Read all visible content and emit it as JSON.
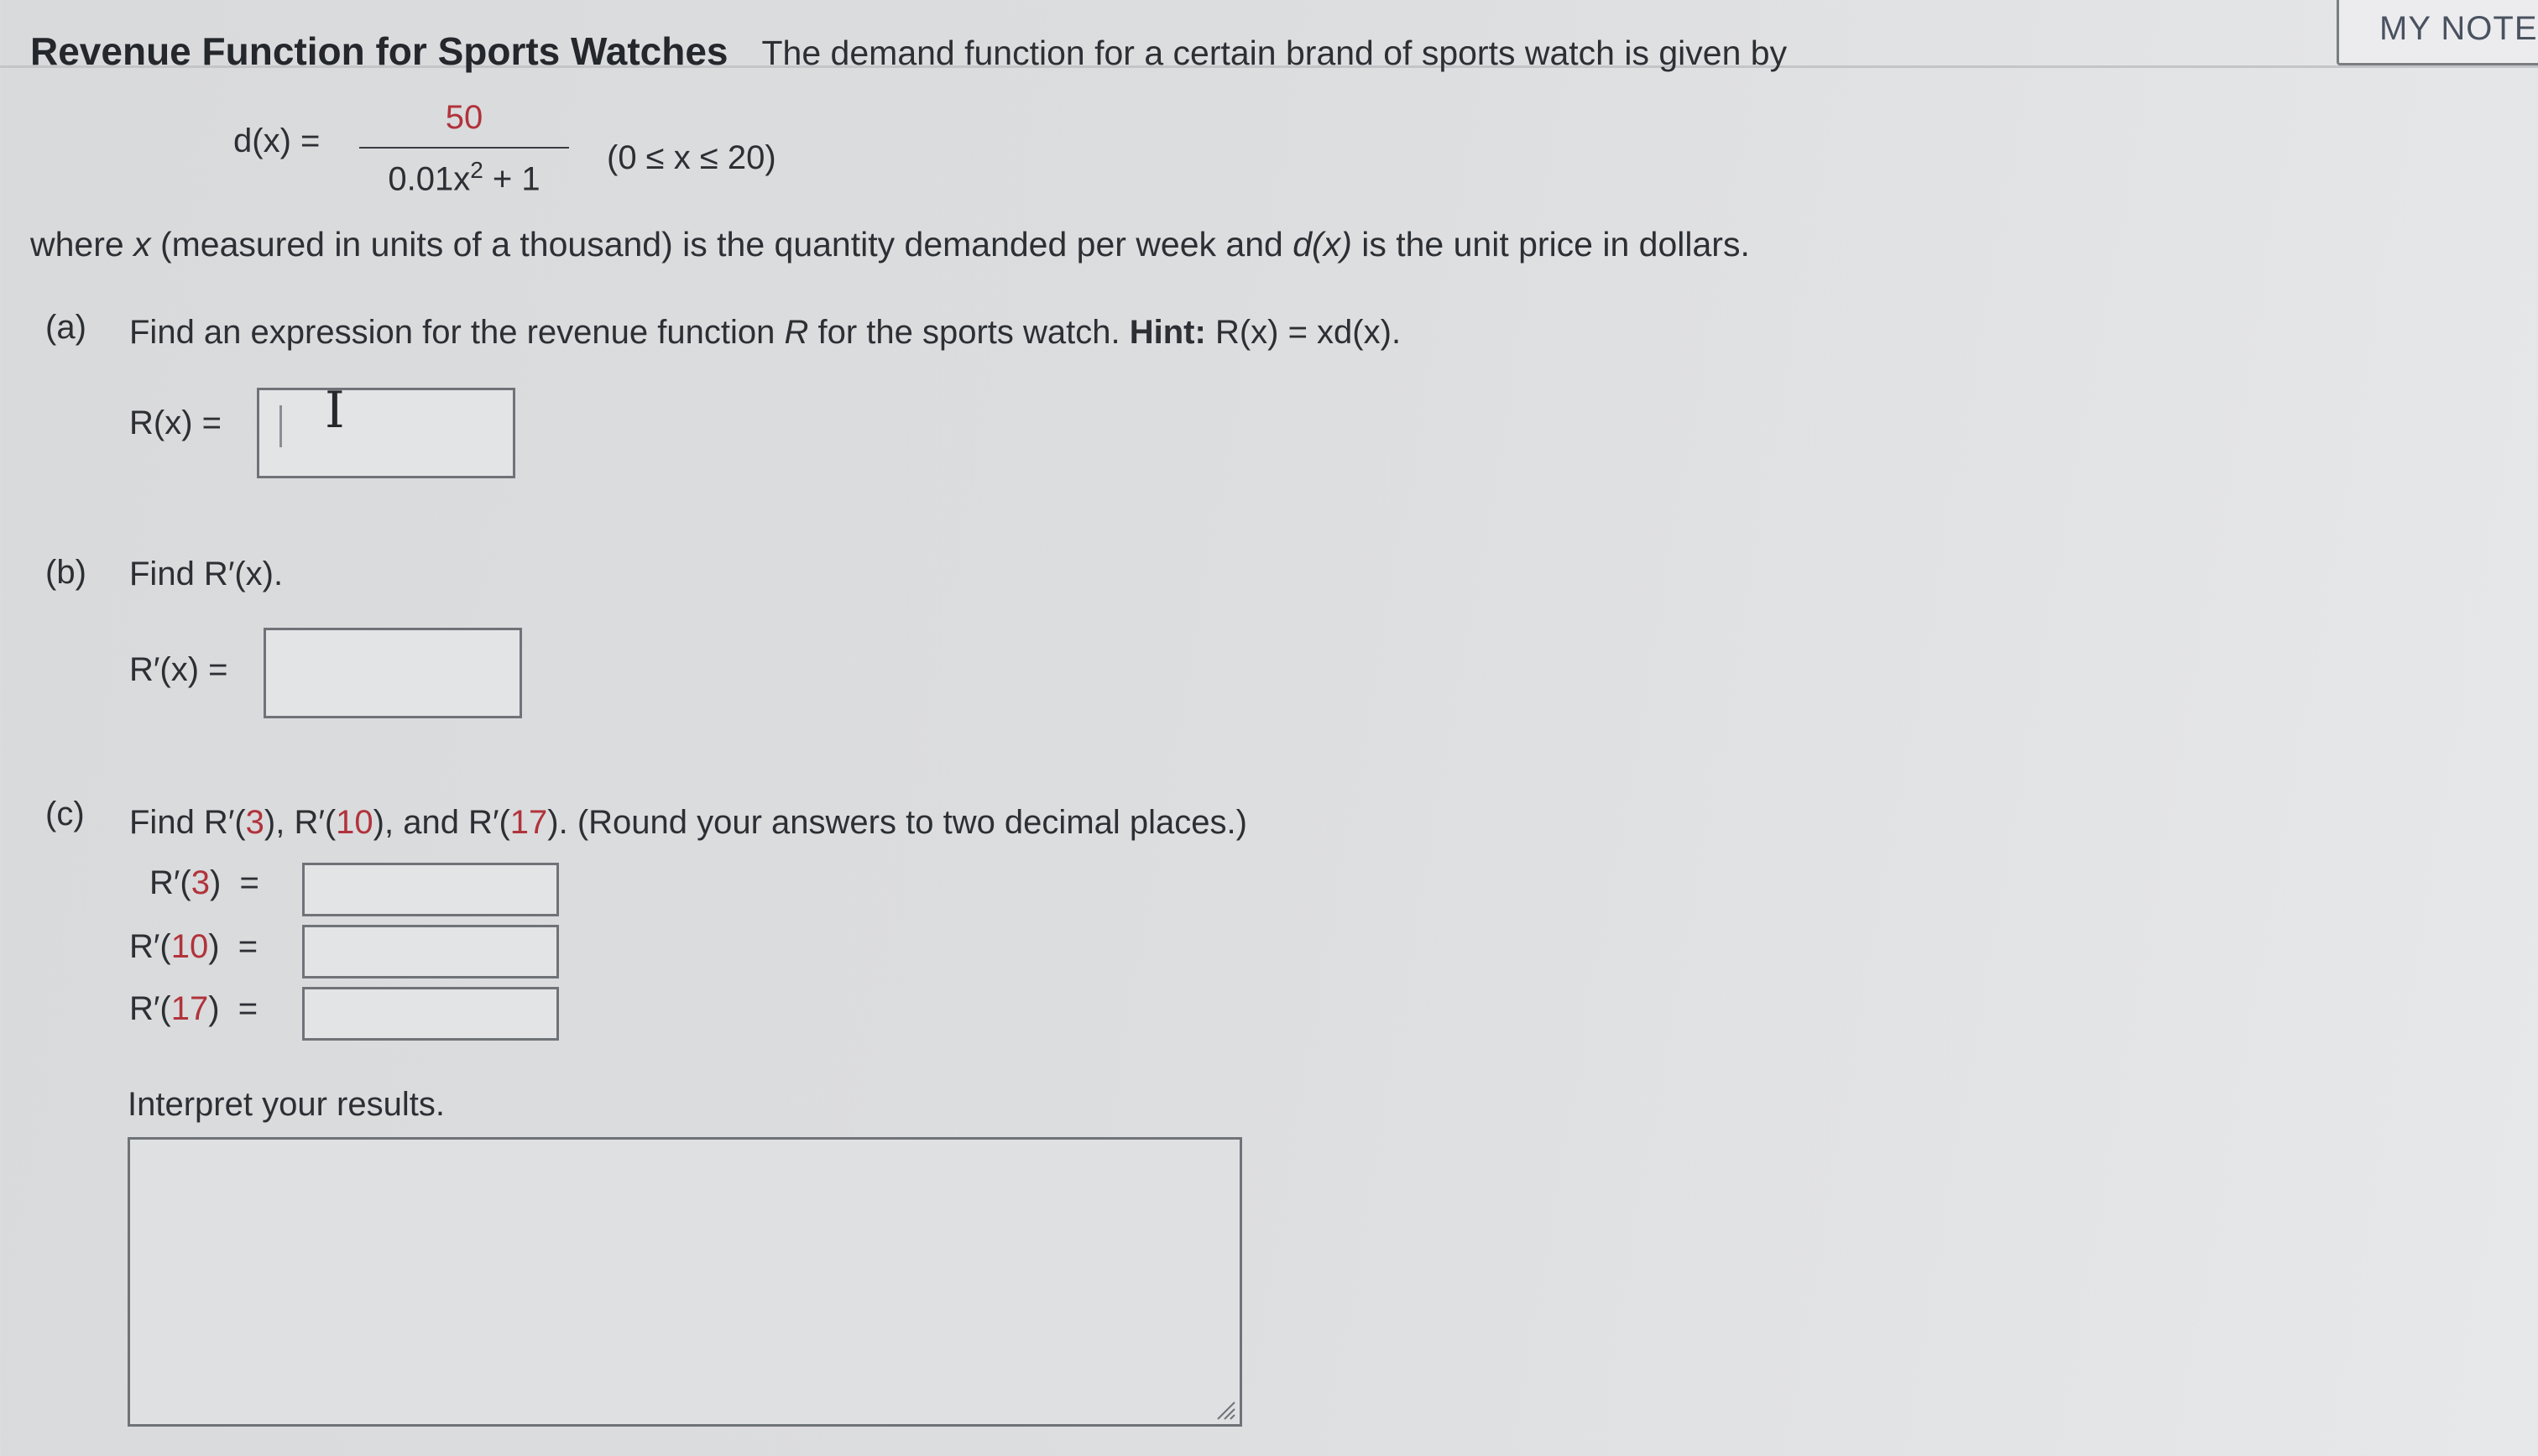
{
  "header": {
    "title": "Revenue Function for Sports Watches",
    "intro": "The demand function for a certain brand of sports watch is given by",
    "my_notes_label": "MY NOTE"
  },
  "formula": {
    "lhs": "d(x) =",
    "numerator": "50",
    "denominator_prefix": "0.01x",
    "denominator_exp": "2",
    "denominator_suffix": " + 1",
    "domain": "(0 ≤ x ≤ 20)"
  },
  "where_text": {
    "part1": "where ",
    "var_x": "x",
    "part2": " (measured in units of a thousand) is the quantity demanded per week and ",
    "dx": "d(x)",
    "part3": " is the unit price in dollars."
  },
  "part_a": {
    "label": "(a)",
    "question_1": "Find an expression for the revenue function ",
    "var_r": "R",
    "question_2": " for the sports watch. ",
    "hint_label": "Hint:",
    "hint_formula": " R(x) = xd(x).",
    "answer_label": "R(x) =",
    "answer_value": ""
  },
  "part_b": {
    "label": "(b)",
    "question": "Find R′(x).",
    "answer_label": "R′(x) =",
    "answer_value": ""
  },
  "part_c": {
    "label": "(c)",
    "q_prefix": "Find R′(",
    "q_3": "3",
    "q_mid1": "), R′(",
    "q_10": "10",
    "q_mid2": "), and R′(",
    "q_17": "17",
    "q_suffix": "). (Round your answers to two decimal places.)",
    "rows": [
      {
        "prefix": "R′(",
        "arg": "3",
        "suffix": ")  =",
        "value": ""
      },
      {
        "prefix": "R′(",
        "arg": "10",
        "suffix": ")  =",
        "value": ""
      },
      {
        "prefix": "R′(",
        "arg": "17",
        "suffix": ")  =",
        "value": ""
      }
    ],
    "interpret_label": "Interpret your results.",
    "interpret_value": ""
  }
}
